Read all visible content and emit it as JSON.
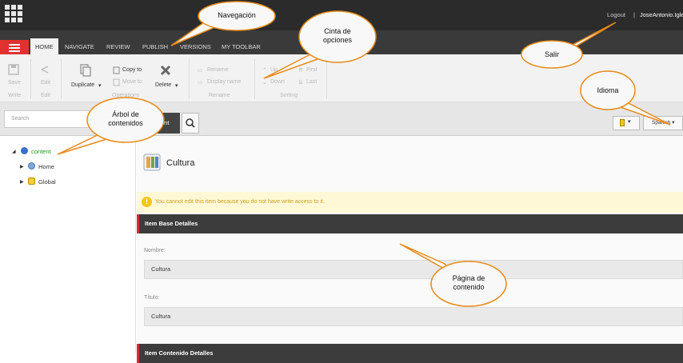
{
  "header": {
    "logout_label": "Logout",
    "separator": "|",
    "user_name": "JoseAntonio.Igle"
  },
  "tabs": [
    "HOME",
    "NAVIGATE",
    "REVIEW",
    "PUBLISH",
    "VERSIONS",
    "MY TOOLBAR"
  ],
  "ribbon": {
    "save": "Save",
    "write": "Write",
    "edit": "Edit",
    "edit_group": "Edit",
    "duplicate": "Duplicate",
    "copy_to": "Copy to",
    "move_to": "Move to",
    "operations": "Operations",
    "delete": "Delete",
    "rename": "Rename",
    "display_name": "Display name",
    "rename_group": "Rename",
    "up": "Up",
    "down": "Down",
    "first": "First",
    "last": "Last",
    "sorting_group": "Sorting"
  },
  "search": {
    "placeholder": "Search",
    "content_tab": "ent",
    "language": "Spanish"
  },
  "tree": {
    "root": "content",
    "items": [
      "Home",
      "Global"
    ]
  },
  "editor": {
    "item_title": "Cultura",
    "warning": "You cannot edit this item because you do not have write access to it.",
    "section1": "Item Base Detalles",
    "section2": "Item Contenido Detalles",
    "fields": [
      {
        "label": "Nombre:",
        "value": "Cultura"
      },
      {
        "label": "Título:",
        "value": "Cultura"
      }
    ]
  },
  "callouts": {
    "navegacion": "Navegación",
    "cinta": "Cinta de opciones",
    "salir": "Salir",
    "idioma": "Idioma",
    "arbol": "Árbol de contenidos",
    "pagina": "Página de contenido"
  },
  "colors": {
    "accent_red": "#e0322f",
    "dark_bar": "#2b2b2b",
    "callout_fill": "#f8f8f8",
    "callout_stroke": "#e88a1a",
    "tree_root_green": "#1a9a1a",
    "warning_yellow": "#f2c811"
  }
}
